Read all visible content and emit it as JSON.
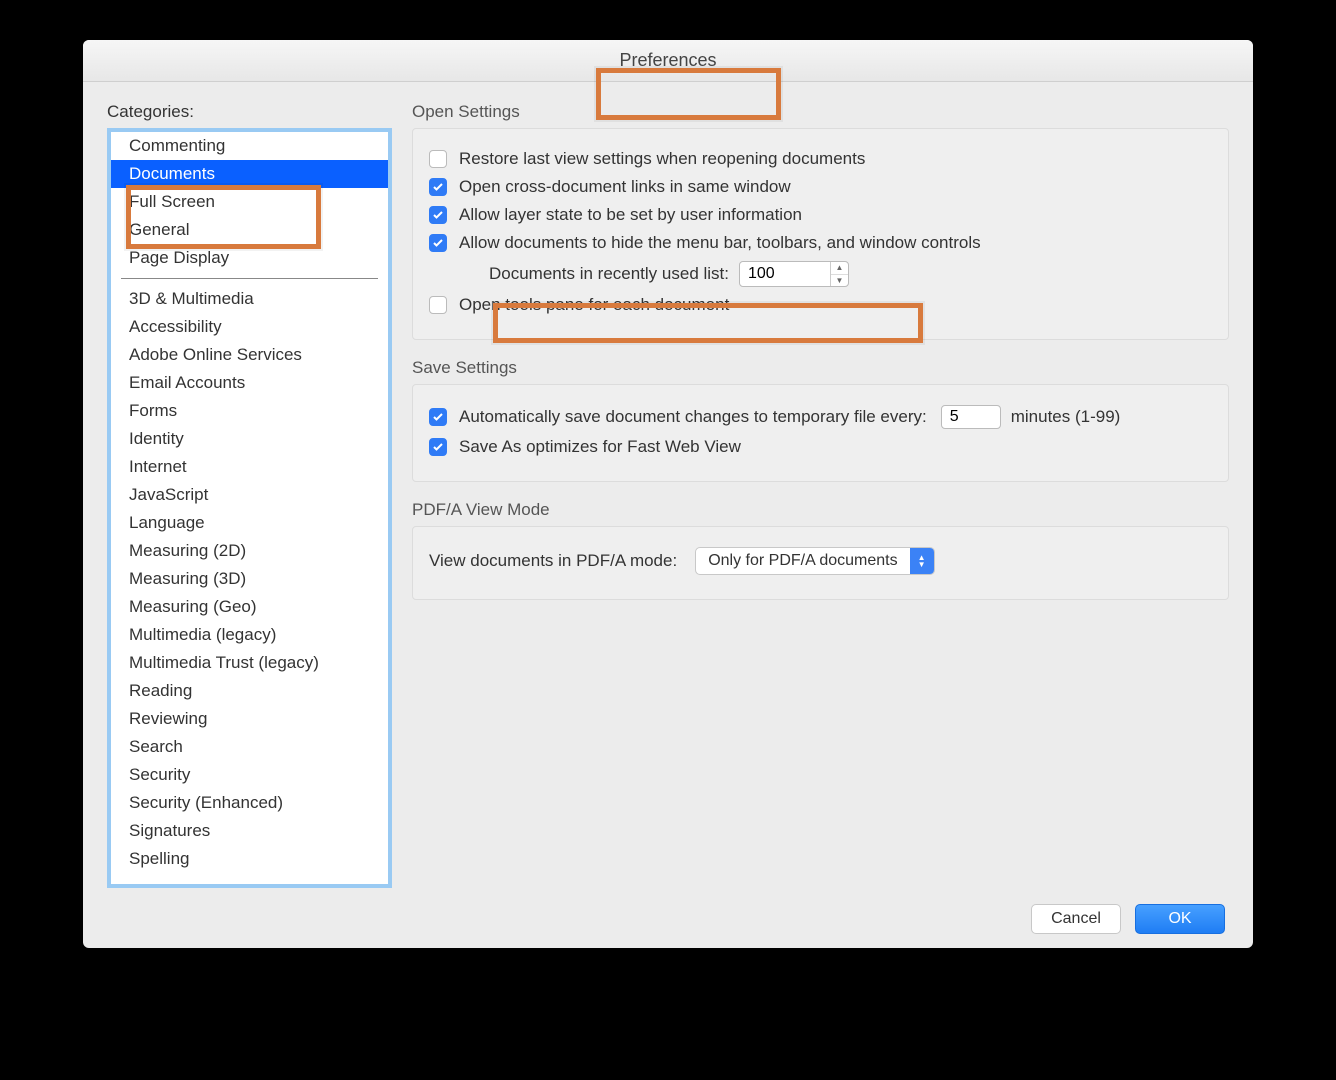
{
  "window": {
    "title": "Preferences"
  },
  "sidebar": {
    "label": "Categories:",
    "groups": [
      [
        "Commenting",
        "Documents",
        "Full Screen",
        "General",
        "Page Display"
      ],
      [
        "3D & Multimedia",
        "Accessibility",
        "Adobe Online Services",
        "Email Accounts",
        "Forms",
        "Identity",
        "Internet",
        "JavaScript",
        "Language",
        "Measuring (2D)",
        "Measuring (3D)",
        "Measuring (Geo)",
        "Multimedia (legacy)",
        "Multimedia Trust (legacy)",
        "Reading",
        "Reviewing",
        "Search",
        "Security",
        "Security (Enhanced)",
        "Signatures",
        "Spelling"
      ]
    ],
    "selected": "Documents"
  },
  "open": {
    "title": "Open Settings",
    "restore": {
      "checked": false,
      "label": "Restore last view settings when reopening documents"
    },
    "crossLinks": {
      "checked": true,
      "label": "Open cross-document links in same window"
    },
    "layerState": {
      "checked": true,
      "label": "Allow layer state to be set by user information"
    },
    "hideMenu": {
      "checked": true,
      "label": "Allow documents to hide the menu bar, toolbars, and window controls"
    },
    "recentLabel": "Documents in recently used list:",
    "recentValue": "100",
    "toolsPane": {
      "checked": false,
      "label": "Open tools pane for each document"
    }
  },
  "save": {
    "title": "Save Settings",
    "autosave": {
      "checked": true,
      "prefix": "Automatically save document changes to temporary file every:",
      "value": "5",
      "suffix": "minutes (1-99)"
    },
    "fastWeb": {
      "checked": true,
      "label": "Save As optimizes for Fast Web View"
    }
  },
  "pdfa": {
    "title": "PDF/A View Mode",
    "label": "View documents in PDF/A mode:",
    "value": "Only for PDF/A documents"
  },
  "footer": {
    "cancel": "Cancel",
    "ok": "OK"
  },
  "colors": {
    "tabInactive": "#9c3d2f",
    "tabActive": "#1a9bff"
  }
}
